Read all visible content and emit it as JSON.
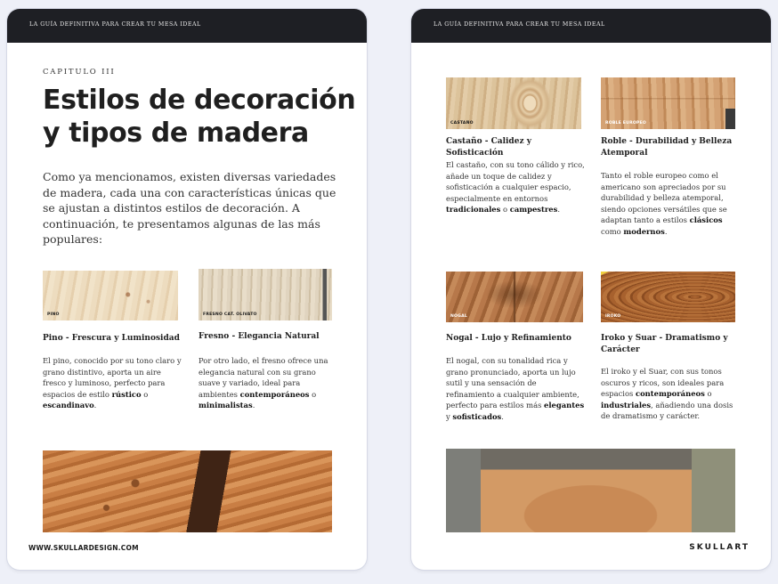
{
  "left_page": {
    "header": "LA GUÍA DEFINITIVA PARA CREAR TU MESA IDEAL",
    "chapter": "CAPITULO III",
    "title": "Estilos de decoración y tipos de madera",
    "intro": "Como ya mencionamos, existen diversas variedades de madera, cada una con características únicas que se ajustan a distintos estilos de decoración. A continuación, te presentamos algunas de las más populares:",
    "cards": [
      {
        "image_label": "PINO",
        "title": "Pino - Frescura y Luminosidad",
        "text_before": "El pino, conocido por su tono claro y grano distintivo, aporta un aire fresco y luminoso, perfecto para espacios de estilo ",
        "bold1": "rústico",
        "text_middle": " o ",
        "bold2": "escandinavo",
        "text_after": "."
      },
      {
        "image_label": "FRESNO CAT. OLIVATO",
        "title": "Fresno - Elegancia Natural",
        "text_before": "Por otro lado, el fresno ofrece una elegancia natural con su grano suave y variado, ideal para ambientes ",
        "bold1": "contemporáneos",
        "text_middle": " o ",
        "bold2": "minimalistas",
        "text_after": "."
      }
    ],
    "footer": "WWW.SKULLARDESIGN.COM"
  },
  "right_page": {
    "header": "LA GUÍA DEFINITIVA PARA CREAR TU MESA IDEAL",
    "cards": [
      {
        "image_label": "CASTAÑO",
        "title": "Castaño - Calidez y Sofisticación",
        "text_before": "El castaño, con su tono cálido y rico, añade un toque de calidez y sofisticación a cualquier espacio, especialmente en entornos ",
        "bold1": "tradicionales",
        "text_middle": " o ",
        "bold2": "campestres",
        "text_after": "."
      },
      {
        "image_label": "ROBLE EUROPEO",
        "title": "Roble - Durabilidad y Belleza Atemporal",
        "text_before": "Tanto el roble europeo como el americano son apreciados por su durabilidad y belleza atemporal, siendo opciones versátiles que se adaptan tanto a estilos ",
        "bold1": "clásicos",
        "text_middle": " como ",
        "bold2": "modernos",
        "text_after": "."
      },
      {
        "image_label": "NOGAL",
        "title": "Nogal - Lujo y Refinamiento",
        "text_before": "El nogal, con su tonalidad rica y grano pronunciado, aporta un lujo sutil y una sensación de refinamiento a cualquier ambiente, perfecto para estilos más ",
        "bold1": "elegantes",
        "text_middle": " y ",
        "bold2": "sofisticados",
        "text_after": "."
      },
      {
        "image_label": "IROKO",
        "title": "Iroko y Suar - Dramatismo y Carácter",
        "text_before": "El iroko y el Suar, con sus tonos oscuros y ricos, son ideales para espacios ",
        "bold1": "contemporáneos",
        "text_middle": " o ",
        "bold2": "industriales",
        "text_after": ", añadiendo una dosis de dramatismo y carácter."
      }
    ],
    "footer": "SKULLART"
  }
}
